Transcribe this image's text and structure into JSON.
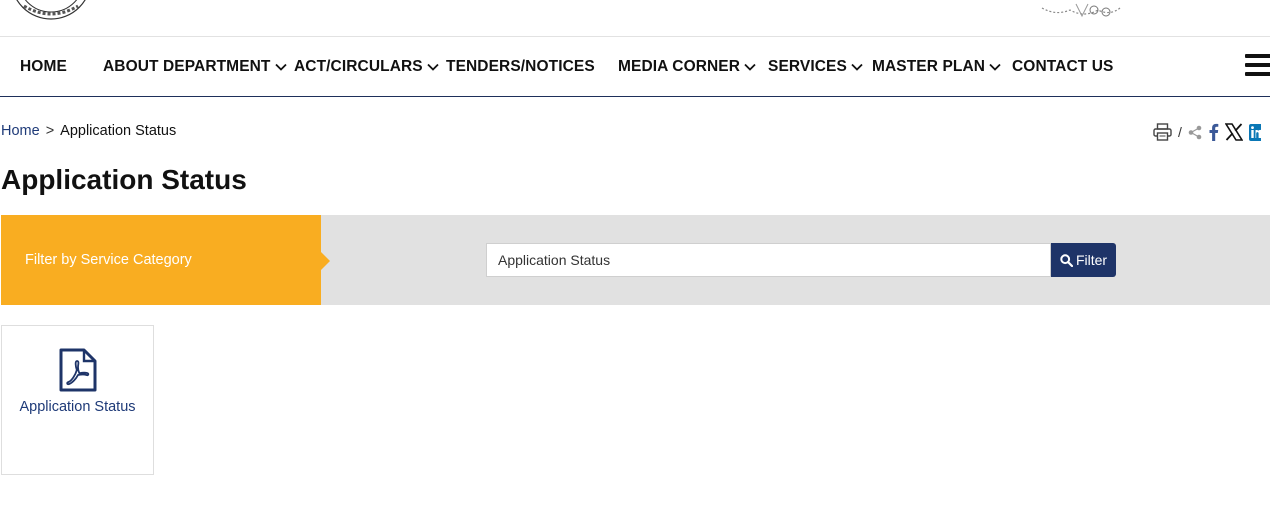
{
  "nav": {
    "items": [
      {
        "label": "HOME",
        "has_dropdown": false
      },
      {
        "label": "ABOUT DEPARTMENT",
        "has_dropdown": true
      },
      {
        "label": "ACT/CIRCULARS",
        "has_dropdown": true
      },
      {
        "label": "TENDERS/NOTICES",
        "has_dropdown": false
      },
      {
        "label": "MEDIA CORNER",
        "has_dropdown": true
      },
      {
        "label": "SERVICES",
        "has_dropdown": true
      },
      {
        "label": "MASTER PLAN",
        "has_dropdown": true
      },
      {
        "label": "CONTACT US",
        "has_dropdown": false
      }
    ],
    "menu_icon": "hamburger-menu-icon"
  },
  "breadcrumb": {
    "home": "Home",
    "separator": ">",
    "current": "Application Status"
  },
  "share": {
    "separator": "/",
    "icons": [
      "print-icon",
      "share-icon",
      "facebook-icon",
      "x-icon",
      "linkedin-icon"
    ]
  },
  "page": {
    "title": "Application Status"
  },
  "filter": {
    "label": "Filter by Service Category",
    "selected_value": "Application Status",
    "button_label": "Filter",
    "button_icon": "search-icon"
  },
  "cards": [
    {
      "label": "Application Status",
      "icon": "pdf-file-icon"
    }
  ],
  "colors": {
    "accent_orange": "#f9ad21",
    "primary_navy": "#1e3468",
    "link_blue": "#1e3a78",
    "filter_bar_gray": "#e1e1e1"
  }
}
